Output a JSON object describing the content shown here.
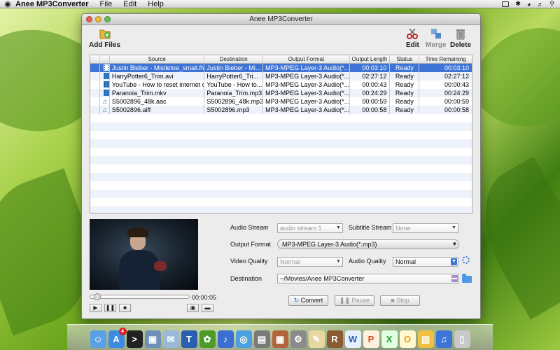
{
  "menubar": {
    "app_name": "Anee MP3Converter",
    "menus": [
      "File",
      "Edit",
      "Help"
    ]
  },
  "window": {
    "title": "Anee MP3Converter"
  },
  "toolbar": {
    "add_files": "Add Files",
    "edit": "Edit",
    "merge": "Merge",
    "delete": "Delete"
  },
  "table": {
    "headers": [
      "Source",
      "Destination",
      "Output Format",
      "Output Length",
      "Status",
      "Time Remaining"
    ],
    "rows": [
      {
        "type": "video",
        "source": "Justin Bieber - Mistletoe_small.flv",
        "destination": "Justin Bieber - Mi...",
        "format": "MP3-MPEG Layer-3 Audio(*...",
        "length": "00:03:10",
        "status": "Ready",
        "remaining": "00:03:10",
        "selected": true
      },
      {
        "type": "video",
        "source": "HarryPotter6_Trim.avi",
        "destination": "HarryPotter6_Tri...",
        "format": "MP3-MPEG Layer-3 Audio(*...",
        "length": "02:27:12",
        "status": "Ready",
        "remaining": "02:27:12",
        "selected": false
      },
      {
        "type": "video",
        "source": "YouTube - How to reset internet c",
        "destination": "YouTube - How to...",
        "format": "MP3-MPEG Layer-3 Audio(*...",
        "length": "00:00:43",
        "status": "Ready",
        "remaining": "00:00:43",
        "selected": false
      },
      {
        "type": "video",
        "source": "Paranoia_Trim.mkv",
        "destination": "Paranoia_Trim.mp3",
        "format": "MP3-MPEG Layer-3 Audio(*...",
        "length": "00:24:29",
        "status": "Ready",
        "remaining": "00:24:29",
        "selected": false
      },
      {
        "type": "audio",
        "source": "S5002896_48k.aac",
        "destination": "S5002896_48k.mp3",
        "format": "MP3-MPEG Layer-3 Audio(*...",
        "length": "00:00:59",
        "status": "Ready",
        "remaining": "00:00:59",
        "selected": false
      },
      {
        "type": "audio",
        "source": "S5002896.aiff",
        "destination": "S5002896.mp3",
        "format": "MP3-MPEG Layer-3 Audio(*...",
        "length": "00:00:58",
        "status": "Ready",
        "remaining": "00:00:58",
        "selected": false
      }
    ]
  },
  "player": {
    "time": "00:00:05",
    "progress": 0.03
  },
  "settings": {
    "audio_stream_label": "Audio Stream",
    "audio_stream_value": "audio stream 1",
    "subtitle_stream_label": "Subtitle Stream",
    "subtitle_stream_value": "None",
    "output_format_label": "Output Format",
    "output_format_value": "MP3-MPEG Layer-3 Audio(*.mp3)",
    "video_quality_label": "Video Quality",
    "video_quality_value": "Normal",
    "audio_quality_label": "Audio Quality",
    "audio_quality_value": "Normal",
    "destination_label": "Destination",
    "destination_value": "~/Movies/Anee MP3Converter"
  },
  "actions": {
    "convert": "Convert",
    "pause": "Pause",
    "stop": "Stop"
  },
  "dock": {
    "app_store_badge": "4",
    "icons": [
      "finder-icon",
      "app-store-icon",
      "terminal-icon",
      "preview-icon",
      "mail-icon",
      "text-app-icon",
      "game-icon",
      "itunes-icon",
      "safari-icon",
      "scanner-icon",
      "photo-icon",
      "system-prefs-icon",
      "notes-icon",
      "rar-icon",
      "word-icon",
      "powerpoint-icon",
      "excel-icon",
      "outlook-icon",
      "photos-icon",
      "mp3-app-icon",
      "trash-icon"
    ]
  },
  "colors": {
    "selection": "#3d74d6",
    "row_alt": "#eef3fb"
  }
}
